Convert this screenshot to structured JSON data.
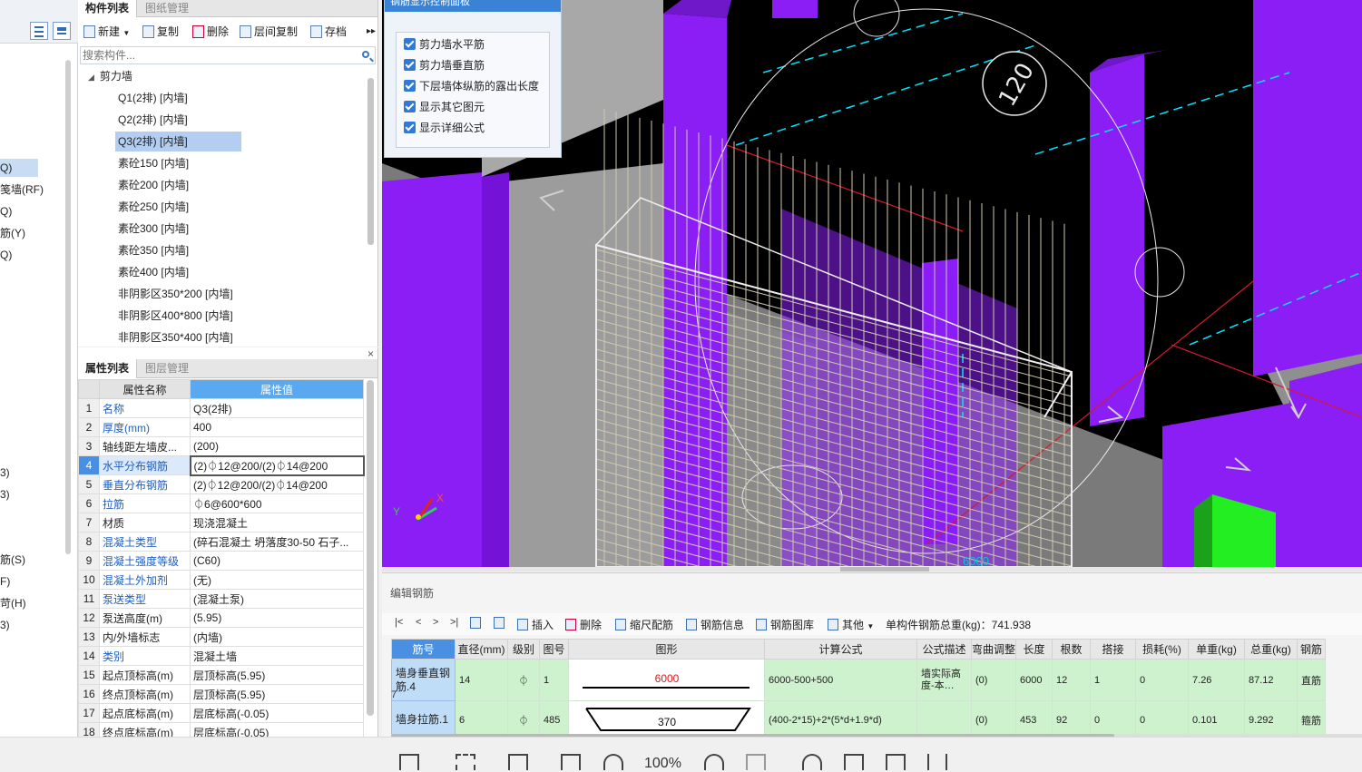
{
  "left_strip": {
    "items": [
      {
        "label": "Q)",
        "selected": true
      },
      {
        "label": "笺墙(RF)",
        "selected": false
      },
      {
        "label": "Q)",
        "selected": false
      },
      {
        "label": "筋(Y)",
        "selected": false
      },
      {
        "label": "Q)",
        "selected": false
      },
      {
        "label": "3)",
        "selected": false
      },
      {
        "label": "3)",
        "selected": false
      },
      {
        "label": "筋(S)",
        "selected": false
      },
      {
        "label": "F)",
        "selected": false
      },
      {
        "label": "苛(H)",
        "selected": false
      },
      {
        "label": "3)",
        "selected": false
      }
    ]
  },
  "component_panel": {
    "tabs": [
      "构件列表",
      "图纸管理"
    ],
    "toolbar": {
      "new": "新建",
      "copy": "复制",
      "delete": "删除",
      "floor_copy": "层间复制",
      "save": "存档"
    },
    "search_placeholder": "搜索构件...",
    "tree_root": "剪力墙",
    "tree_items": [
      "Q1(2排) [内墙]",
      "Q2(2排) [内墙]",
      "Q3(2排) [内墙]",
      "素砼150 [内墙]",
      "素砼200 [内墙]",
      "素砼250 [内墙]",
      "素砼300 [内墙]",
      "素砼350 [内墙]",
      "素砼400 [内墙]",
      "非阴影区350*200 [内墙]",
      "非阴影区400*800 [内墙]",
      "非阴影区350*400 [内墙]"
    ],
    "selected_index": 2
  },
  "attr_panel": {
    "close": "×",
    "tabs": [
      "属性列表",
      "图层管理"
    ],
    "headers": {
      "name": "属性名称",
      "value": "属性值"
    },
    "rows": [
      {
        "no": "1",
        "name": "名称",
        "value": "Q3(2排)",
        "blue": true
      },
      {
        "no": "2",
        "name": "厚度(mm)",
        "value": "400",
        "blue": true
      },
      {
        "no": "3",
        "name": "轴线距左墙皮...",
        "value": "(200)",
        "blue": false
      },
      {
        "no": "4",
        "name": "水平分布钢筋",
        "value": "(2)⏀12@200/(2)⏀14@200",
        "blue": true
      },
      {
        "no": "5",
        "name": "垂直分布钢筋",
        "value": "(2)⏀12@200/(2)⏀14@200",
        "blue": true
      },
      {
        "no": "6",
        "name": "拉筋",
        "value": "⏀6@600*600",
        "blue": true
      },
      {
        "no": "7",
        "name": "材质",
        "value": "现浇混凝土",
        "blue": false
      },
      {
        "no": "8",
        "name": "混凝土类型",
        "value": "(碎石混凝土 坍落度30-50 石子...",
        "blue": true
      },
      {
        "no": "9",
        "name": "混凝土强度等级",
        "value": "(C60)",
        "blue": true
      },
      {
        "no": "10",
        "name": "混凝土外加剂",
        "value": "(无)",
        "blue": true
      },
      {
        "no": "11",
        "name": "泵送类型",
        "value": "(混凝土泵)",
        "blue": true
      },
      {
        "no": "12",
        "name": "泵送高度(m)",
        "value": "(5.95)",
        "blue": false
      },
      {
        "no": "13",
        "name": "内/外墙标志",
        "value": "(内墙)",
        "blue": false
      },
      {
        "no": "14",
        "name": "类别",
        "value": "混凝土墙",
        "blue": true
      },
      {
        "no": "15",
        "name": "起点顶标高(m)",
        "value": "层顶标高(5.95)",
        "blue": false
      },
      {
        "no": "16",
        "name": "终点顶标高(m)",
        "value": "层顶标高(5.95)",
        "blue": false
      },
      {
        "no": "17",
        "name": "起点底标高(m)",
        "value": "层底标高(-0.05)",
        "blue": false
      },
      {
        "no": "18",
        "name": "终点底标高(m)",
        "value": "层底标高(-0.05)",
        "blue": false
      }
    ],
    "selected_row": 3
  },
  "view3d": {
    "panel_title": "钢筋显示控制面板",
    "options": [
      {
        "label": "剪力墙水平筋",
        "checked": true
      },
      {
        "label": "剪力墙垂直筋",
        "checked": true
      },
      {
        "label": "下层墙体纵筋的露出长度",
        "checked": true
      },
      {
        "label": "显示其它图元",
        "checked": true
      },
      {
        "label": "显示详细公式",
        "checked": true
      }
    ],
    "circle_label": "120",
    "axis_x": "X",
    "axis_y": "Y",
    "bottom_label": "6000"
  },
  "rebar_panel": {
    "title": "编辑钢筋",
    "toolbar": {
      "first": "|<",
      "prev": "<",
      "next": ">",
      "last": ">|",
      "insert": "插入",
      "delete": "删除",
      "scale_rebar": "缩尺配筋",
      "rebar_info": "钢筋信息",
      "rebar_library": "钢筋图库",
      "other": "其他",
      "total_weight": "单构件钢筋总重(kg)：741.938"
    },
    "columns": [
      "筋号",
      "直径(mm)",
      "级别",
      "图号",
      "图形",
      "计算公式",
      "公式描述",
      "弯曲调整",
      "长度",
      "根数",
      "搭接",
      "损耗(%)",
      "单重(kg)",
      "总重(kg)",
      "钢筋"
    ],
    "rows": [
      {
        "idx": "",
        "name": "墙身垂直钢筋.4",
        "diameter": "14",
        "grade": "⏀",
        "fig_no": "1",
        "shape_value": "6000",
        "formula": "6000-500+500",
        "desc": "墙实际高度-本…",
        "bend": "(0)",
        "length": "6000",
        "count": "12",
        "lap": "1",
        "loss": "0",
        "unit_weight": "7.26",
        "total_weight": "87.12",
        "type": "直筋"
      },
      {
        "idx": "7",
        "name": "墙身拉筋.1",
        "diameter": "6",
        "grade": "⏀",
        "fig_no": "485",
        "shape_value": "370",
        "formula": "(400-2*15)+2*(5*d+1.9*d)",
        "desc": "",
        "bend": "(0)",
        "length": "453",
        "count": "92",
        "lap": "0",
        "loss": "0",
        "unit_weight": "0.101",
        "total_weight": "9.292",
        "type": "箍筋"
      }
    ]
  },
  "status_bar": {
    "zoom": "100%"
  },
  "colors": {
    "accent_blue": "#4a90e2",
    "wall_purple": "#8b1df5",
    "green_block": "#22ee22",
    "rebar_row_green": "#cdf2cd"
  }
}
